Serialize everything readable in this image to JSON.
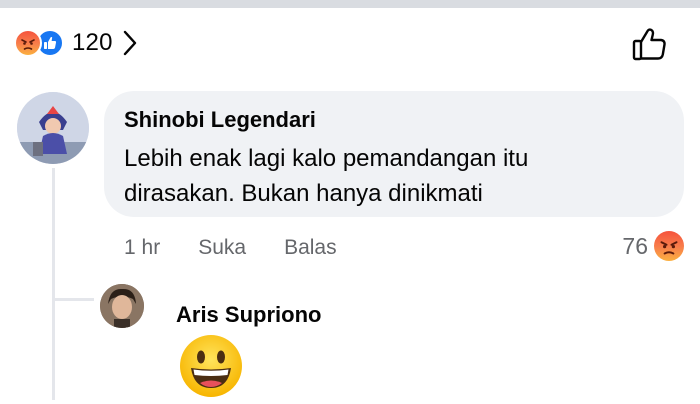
{
  "reactions": {
    "count": "120",
    "icons": [
      "angry-icon",
      "like-icon",
      "chevron-right-icon",
      "like-outline-icon"
    ]
  },
  "comment": {
    "author": "Shinobi Legendari",
    "text_line1": "Lebih enak lagi kalo pemandangan itu",
    "text_line2": "dirasakan. Bukan hanya dinikmati",
    "time": "1 hr",
    "like_label": "Suka",
    "reply_label": "Balas",
    "reaction_count": "76",
    "reaction_icon": "angry-icon"
  },
  "reply": {
    "author": "Aris Supriono",
    "content_icon": "grinning-face-emoji"
  },
  "colors": {
    "bubble_bg": "#f0f2f5",
    "secondary_text": "#65676b",
    "like_blue": "#1877f2",
    "angry_orange": "#f8804b"
  }
}
